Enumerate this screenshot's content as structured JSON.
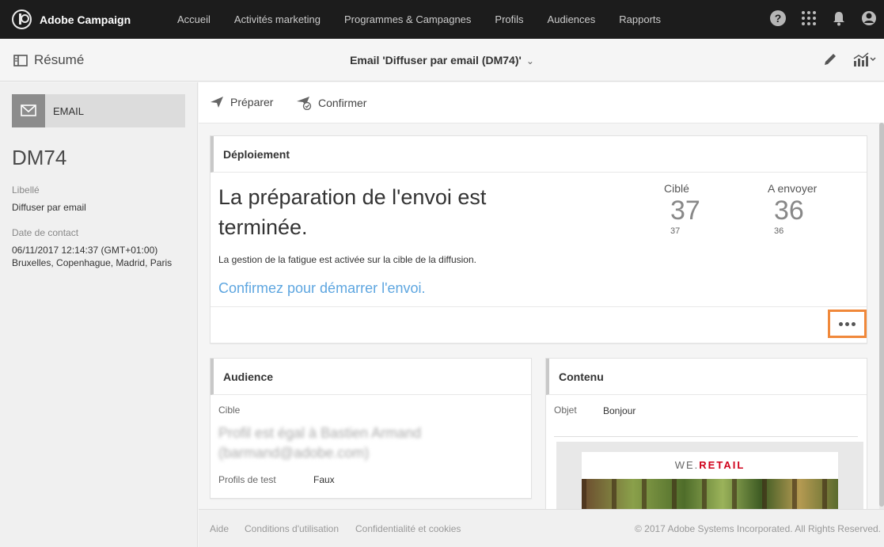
{
  "topbar": {
    "brand": "Adobe Campaign",
    "nav": [
      "Accueil",
      "Activités marketing",
      "Programmes & Campagnes",
      "Profils",
      "Audiences",
      "Rapports"
    ],
    "icons": [
      "help-icon",
      "apps-icon",
      "bell-icon",
      "user-icon"
    ]
  },
  "subheader": {
    "summary_label": "Résumé",
    "title": "Email 'Diffuser par email (DM74)'",
    "icons": [
      "edit-icon",
      "report-icon"
    ]
  },
  "left": {
    "type_label": "EMAIL",
    "code": "DM74",
    "label_caption": "Libellé",
    "label_value": "Diffuser par email",
    "contact_caption": "Date de contact",
    "contact_date": "06/11/2017 12:14:37 (GMT+01:00)",
    "contact_zone": "Bruxelles, Copenhague, Madrid, Paris"
  },
  "toolbar": {
    "prepare_label": "Préparer",
    "confirm_label": "Confirmer"
  },
  "deployment": {
    "title": "Déploiement",
    "message": "La préparation de l'envoi est terminée.",
    "fatigue_note": "La gestion de la fatigue est activée sur la cible de la diffusion.",
    "confirm_link": "Confirmez pour démarrer l'envoi.",
    "targeted_label": "Ciblé",
    "targeted_value": "37",
    "targeted_sub": "37",
    "tosend_label": "A envoyer",
    "tosend_value": "36",
    "tosend_sub": "36"
  },
  "audience": {
    "title": "Audience",
    "target_label": "Cible",
    "target_value": "Profil est égal à Bastien Armand (barmand@adobe.com)",
    "test_label": "Profils de test",
    "test_value": "Faux"
  },
  "content": {
    "title": "Contenu",
    "subject_label": "Objet",
    "subject_value": "Bonjour",
    "logo_prefix": "WE.",
    "logo_brand": "RETAIL"
  },
  "footer": {
    "links": [
      "Aide",
      "Conditions d'utilisation",
      "Confidentialité et cookies"
    ],
    "copyright": "© 2017 Adobe Systems Incorporated. All Rights Reserved."
  },
  "colors": {
    "topbar_bg": "#1c1c1c",
    "link_blue": "#5ea6e0",
    "highlight_orange": "#f0883a",
    "retail_red": "#d0021b"
  }
}
